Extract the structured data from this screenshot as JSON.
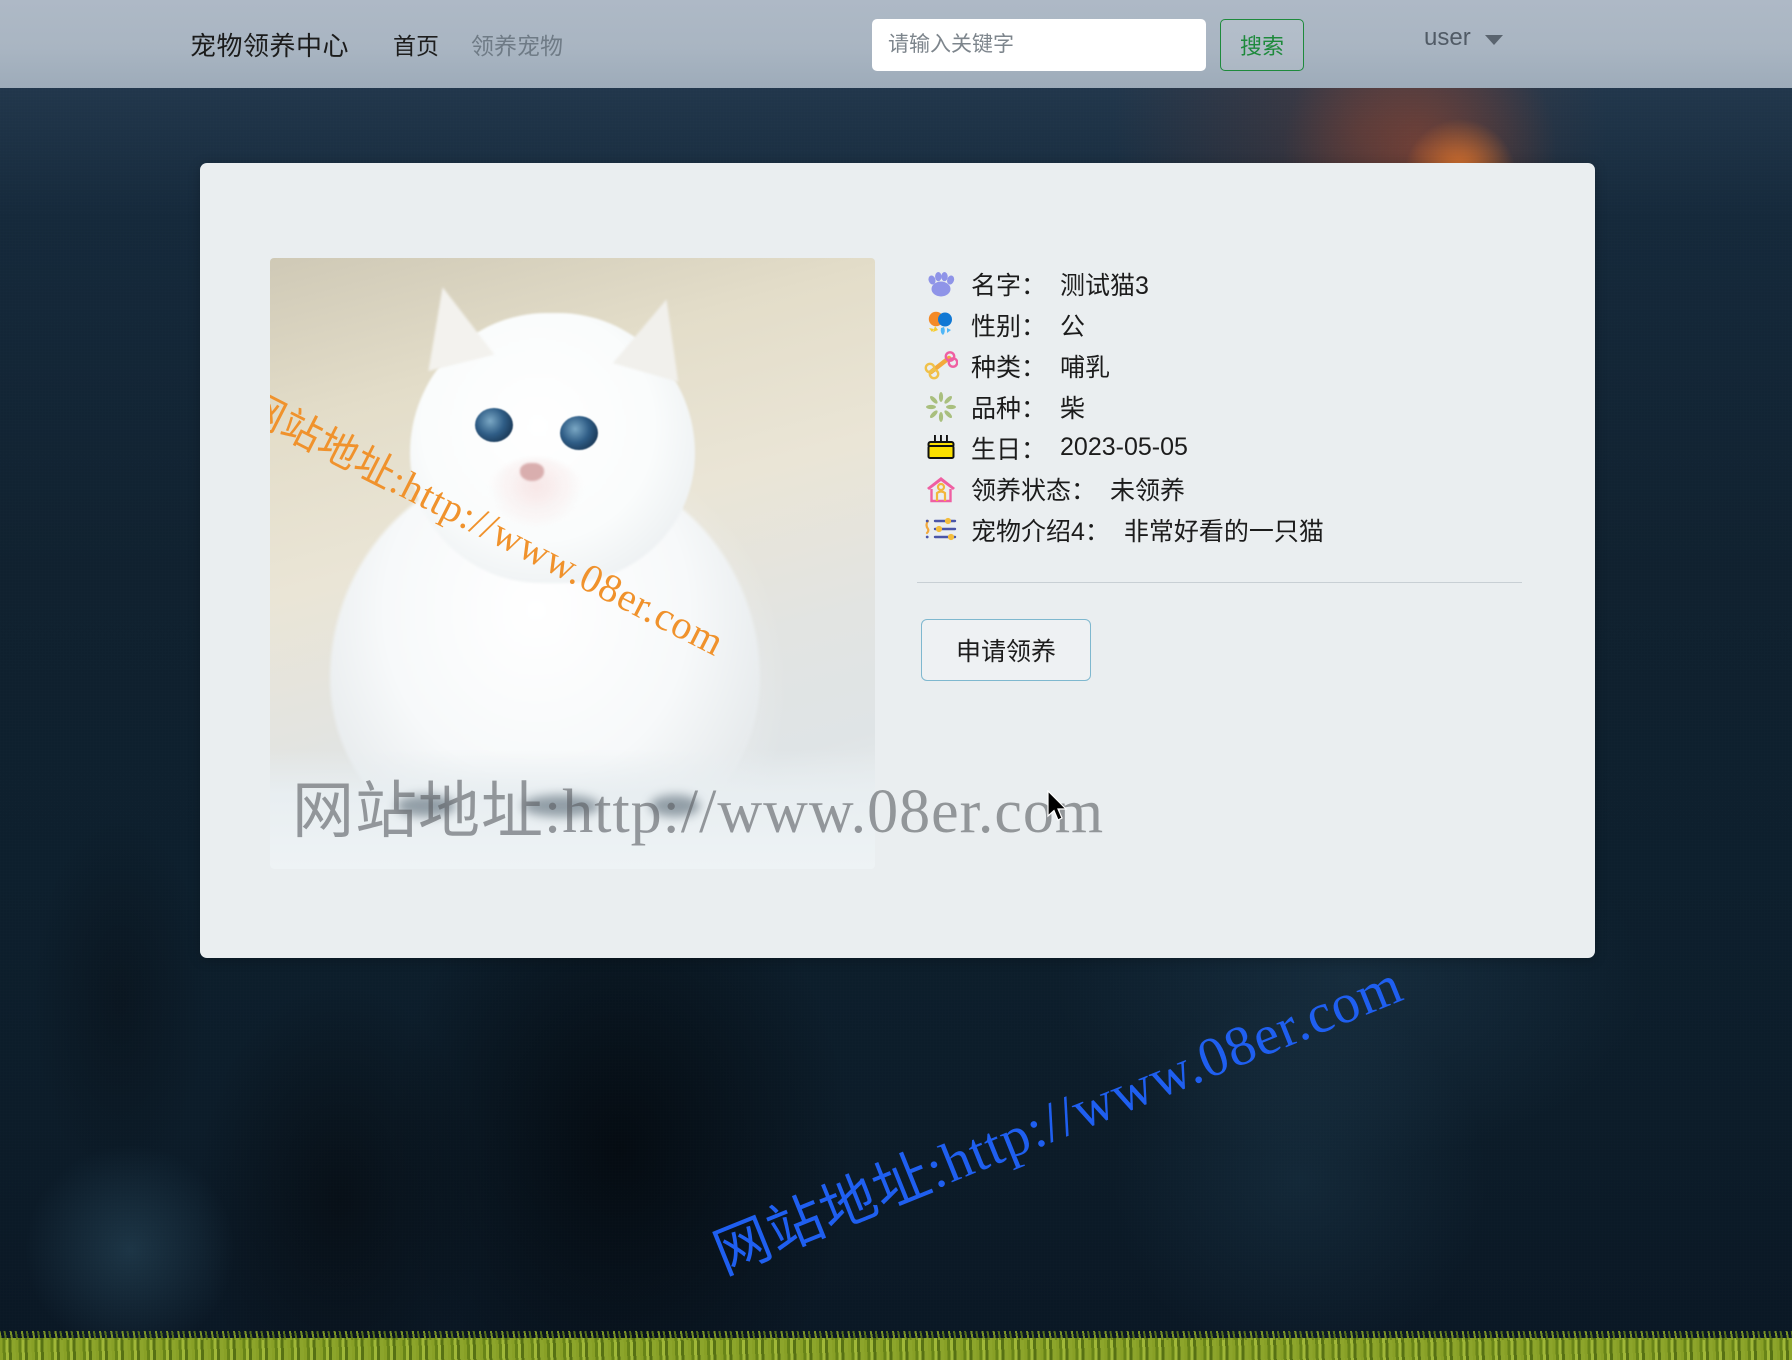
{
  "navbar": {
    "brand": "宠物领养中心",
    "links": [
      {
        "label": "首页",
        "active": true
      },
      {
        "label": "领养宠物",
        "active": false
      }
    ],
    "search": {
      "placeholder": "请输入关键字",
      "value": "",
      "button_label": "搜索",
      "button_color": "#1e8a3c"
    },
    "user": {
      "name": "user",
      "caret_icon": "chevron-down-icon"
    },
    "background_color": "#a9b5c2"
  },
  "card": {
    "background_color": "#eaeef0",
    "photo": {
      "alt": "白色长毛小猫",
      "watermark": "网站地址:http://www.08er.com",
      "watermark_color": "#f0922c"
    },
    "details": [
      {
        "icon": "paw-print-icon",
        "label": "名字：",
        "value": "测试猫3"
      },
      {
        "icon": "balloons-icon",
        "label": "性别：",
        "value": "公"
      },
      {
        "icon": "bone-icon",
        "label": "种类：",
        "value": "哺乳"
      },
      {
        "icon": "sparkle-icon",
        "label": "品种：",
        "value": "柴"
      },
      {
        "icon": "birthday-cake-icon",
        "label": "生日：",
        "value": "2023-05-05"
      },
      {
        "icon": "house-icon",
        "label": "领养状态：",
        "value": "未领养"
      },
      {
        "icon": "sliders-icon",
        "label": "宠物介绍4：",
        "value": "非常好看的一只猫"
      }
    ],
    "apply_button": {
      "label": "申请领养",
      "border_color": "#7fb8cf"
    }
  },
  "watermarks": {
    "gray": "网站地址:http://www.08er.com",
    "blue": "网站地址:http://www.08er.com",
    "blue_color": "#1f5ff0",
    "gray_color": "#5c6064"
  },
  "page": {
    "background_color": "#102536"
  }
}
